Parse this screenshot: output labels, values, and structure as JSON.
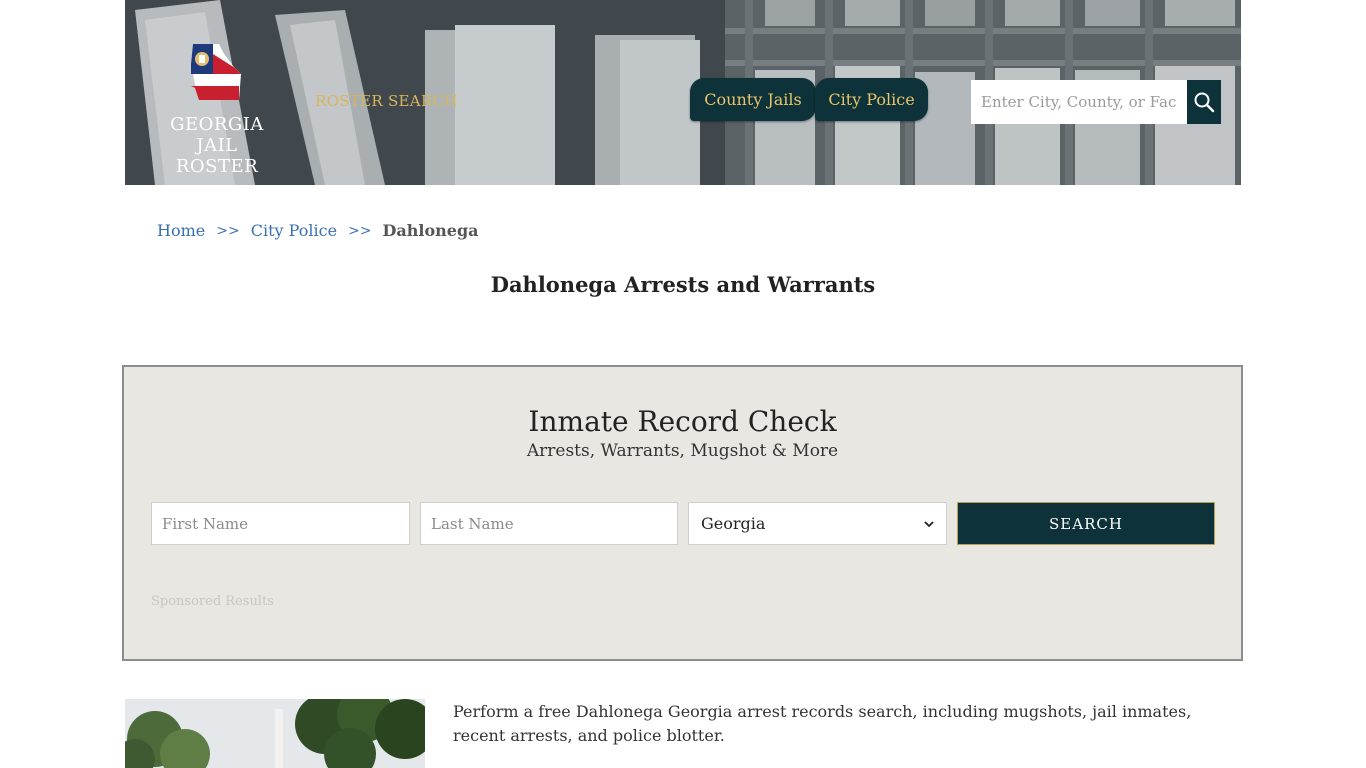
{
  "header": {
    "logo_line1": "GEORGIA",
    "logo_line2": "JAIL ROSTER",
    "roster_search_label": "ROSTER SEARCH",
    "nav": [
      {
        "label": "County Jails"
      },
      {
        "label": "City Police"
      }
    ],
    "search_placeholder": "Enter City, County, or Facility"
  },
  "breadcrumb": {
    "home": "Home",
    "separator": ">>",
    "city_police": "City Police",
    "current": "Dahlonega"
  },
  "page_title": "Dahlonega Arrests and Warrants",
  "record_check": {
    "title": "Inmate Record Check",
    "subtitle": "Arrests, Warrants, Mugshot & More",
    "first_name_placeholder": "First Name",
    "last_name_placeholder": "Last Name",
    "state_selected": "Georgia",
    "search_label": "SEARCH",
    "sponsored_label": "Sponsored Results"
  },
  "intro_text": "Perform a free Dahlonega Georgia arrest records search, including mugshots, jail inmates, recent arrests, and police blotter.",
  "colors": {
    "accent_dark": "#0e3239",
    "gold": "#e9c46a",
    "link": "#3a6fb0",
    "panel_bg": "#e9e7e2"
  }
}
